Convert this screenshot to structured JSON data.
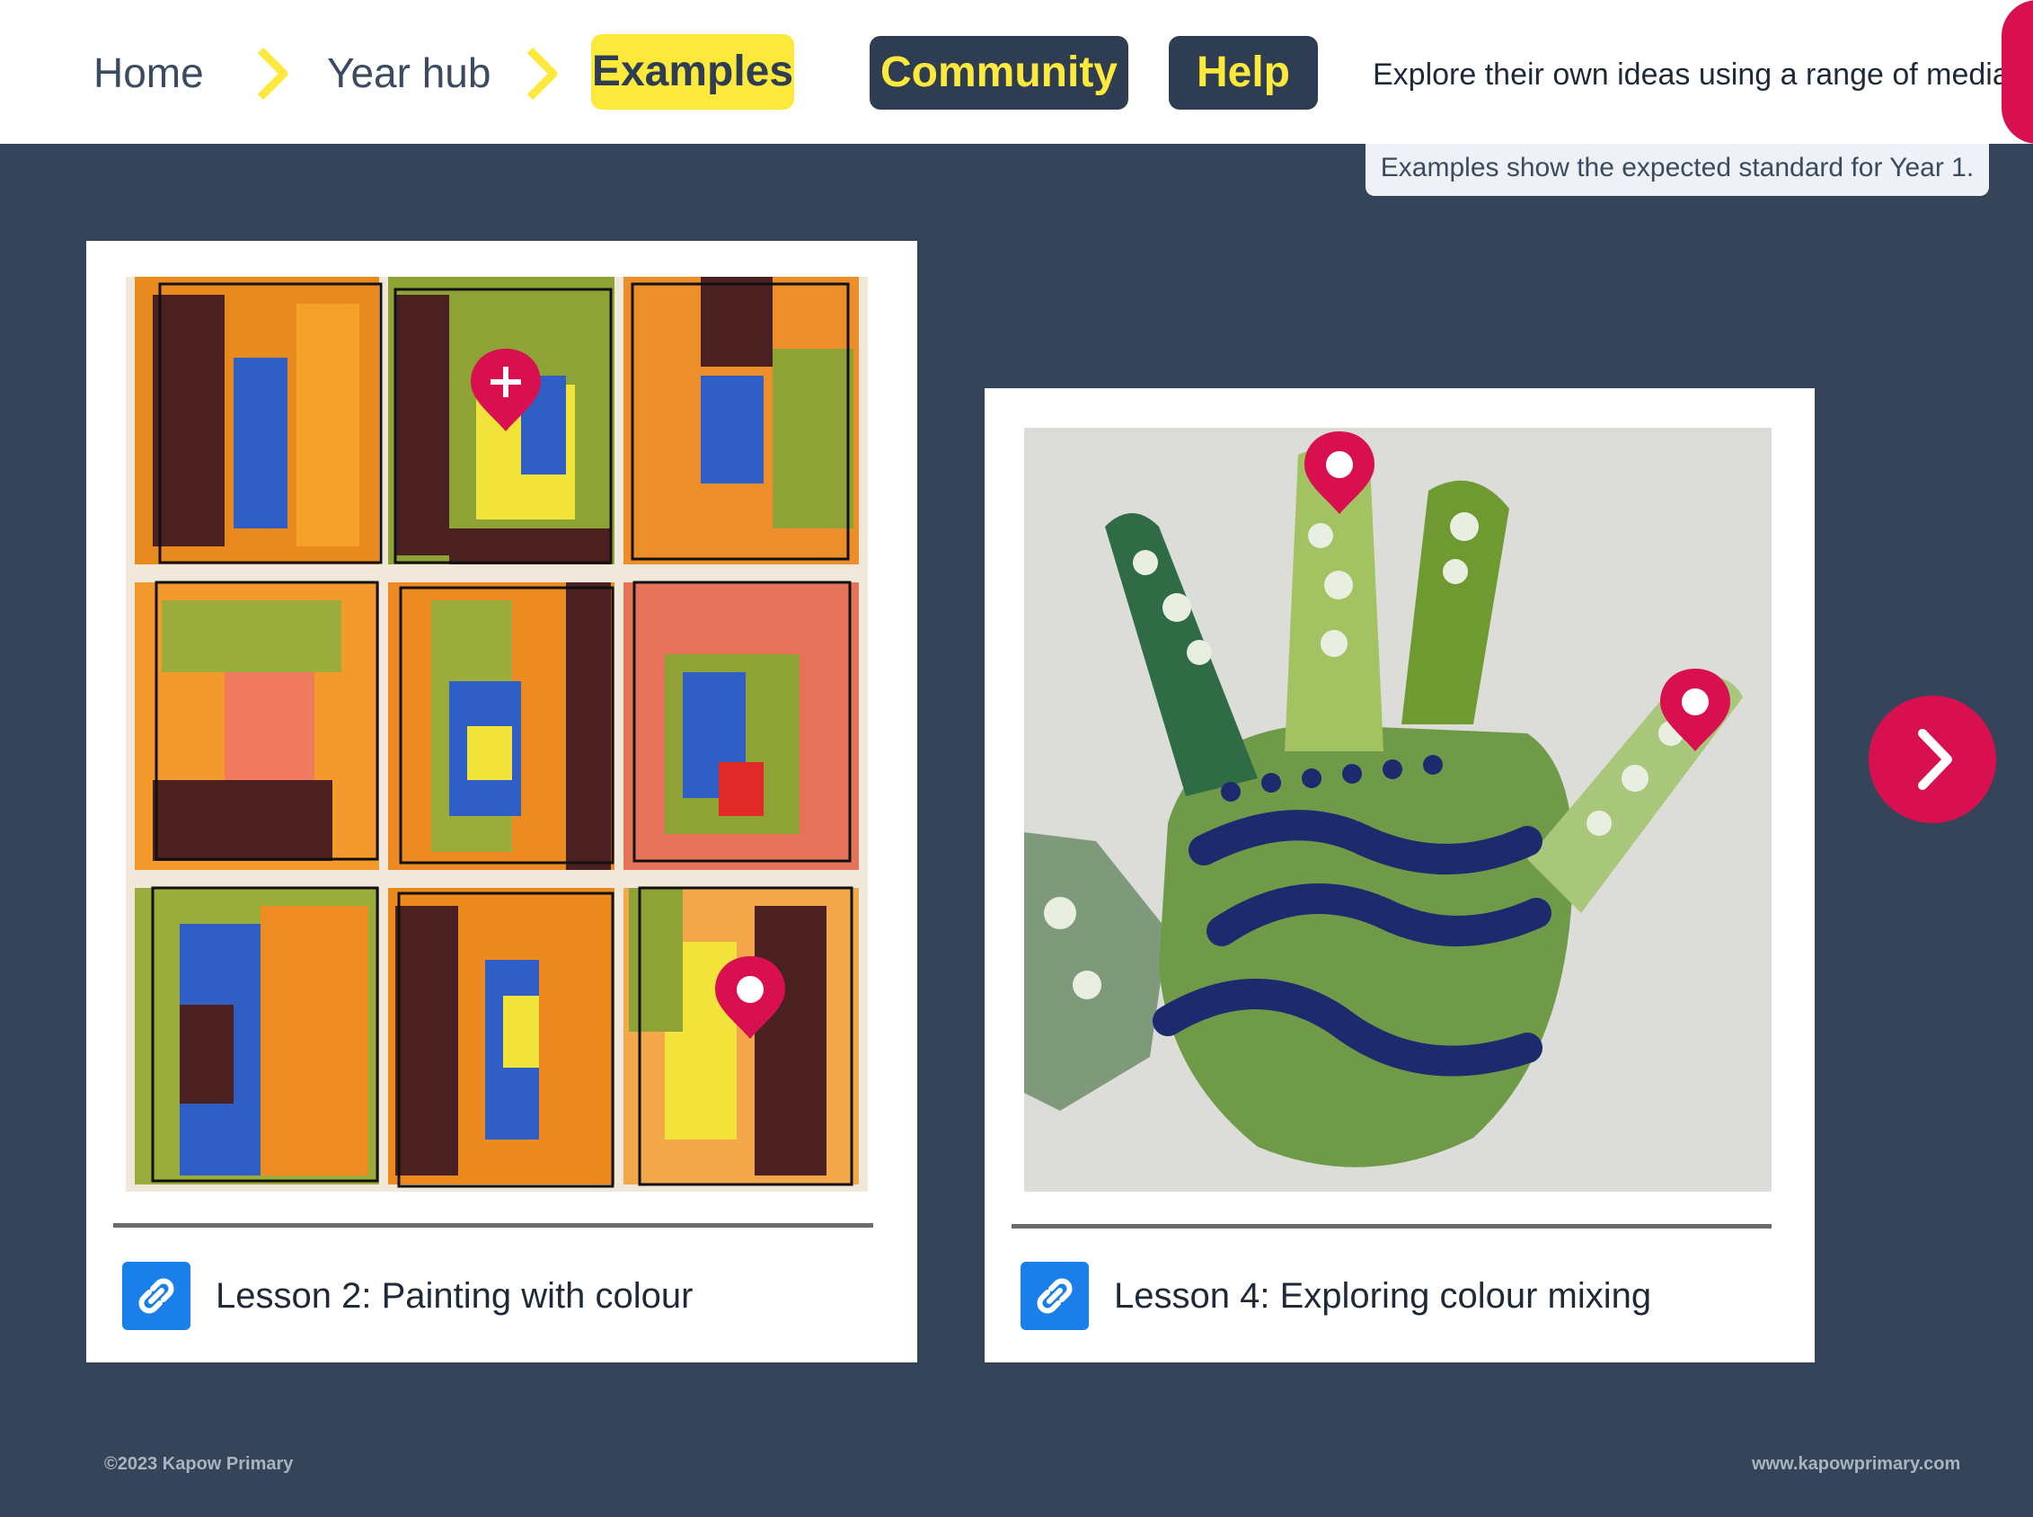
{
  "breadcrumb": {
    "home": "Home",
    "year_hub": "Year hub",
    "examples": "Examples"
  },
  "nav": {
    "community": "Community",
    "help": "Help"
  },
  "header": {
    "tagline": "Explore their own ideas using a range of media.",
    "note": "Examples show the expected standard for Year 1."
  },
  "colors": {
    "background": "#364459",
    "accent_yellow": "#fde93b",
    "accent_pink": "#d8104f",
    "link_blue": "#1a7fe8"
  },
  "cards": [
    {
      "lesson": "Lesson 2: Painting with colour",
      "image": "painted-numbers-grid",
      "link_icon": "link-icon"
    },
    {
      "lesson": "Lesson 4: Exploring colour mixing",
      "image": "painted-handprint",
      "link_icon": "link-icon"
    }
  ],
  "footer": {
    "copyright": "©2023 Kapow Primary",
    "website": "www.kapowprimary.com"
  }
}
